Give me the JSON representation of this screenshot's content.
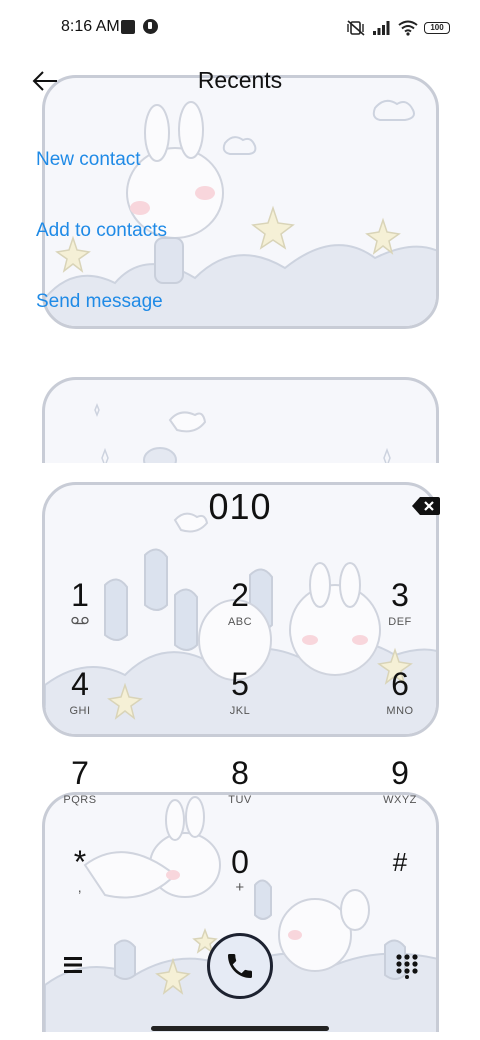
{
  "status_bar": {
    "time": "8:16 AM",
    "battery": "100",
    "icons": [
      "notification-square-icon",
      "app-status-icon",
      "mute-vibrate-icon",
      "signal-icon",
      "wifi-icon",
      "battery-icon"
    ]
  },
  "header": {
    "title": "Recents",
    "back_icon": "arrow-left-icon"
  },
  "actions": {
    "new_contact": "New contact",
    "add_to_contacts": "Add to contacts",
    "send_message": "Send message"
  },
  "dialer": {
    "number": "010",
    "backspace_icon": "backspace-icon"
  },
  "keypad": [
    {
      "digit": "1",
      "letters": "",
      "icon": "voicemail-icon"
    },
    {
      "digit": "2",
      "letters": "ABC"
    },
    {
      "digit": "3",
      "letters": "DEF"
    },
    {
      "digit": "4",
      "letters": "GHI"
    },
    {
      "digit": "5",
      "letters": "JKL"
    },
    {
      "digit": "6",
      "letters": "MNO"
    },
    {
      "digit": "7",
      "letters": "PQRS"
    },
    {
      "digit": "8",
      "letters": "TUV"
    },
    {
      "digit": "9",
      "letters": "WXYZ"
    },
    {
      "digit": "*",
      "letters": ","
    },
    {
      "digit": "0",
      "letters": "+"
    },
    {
      "digit": "#",
      "letters": ""
    }
  ],
  "bottom_bar": {
    "menu_icon": "menu-icon",
    "call_icon": "phone-icon",
    "dialpad_icon": "dialpad-grid-icon"
  },
  "colors": {
    "link": "#1f8ae6",
    "card_border": "#c8ccd6",
    "card_bg": "#f6f7fb",
    "call_button_bg": "#e6ebf5"
  }
}
